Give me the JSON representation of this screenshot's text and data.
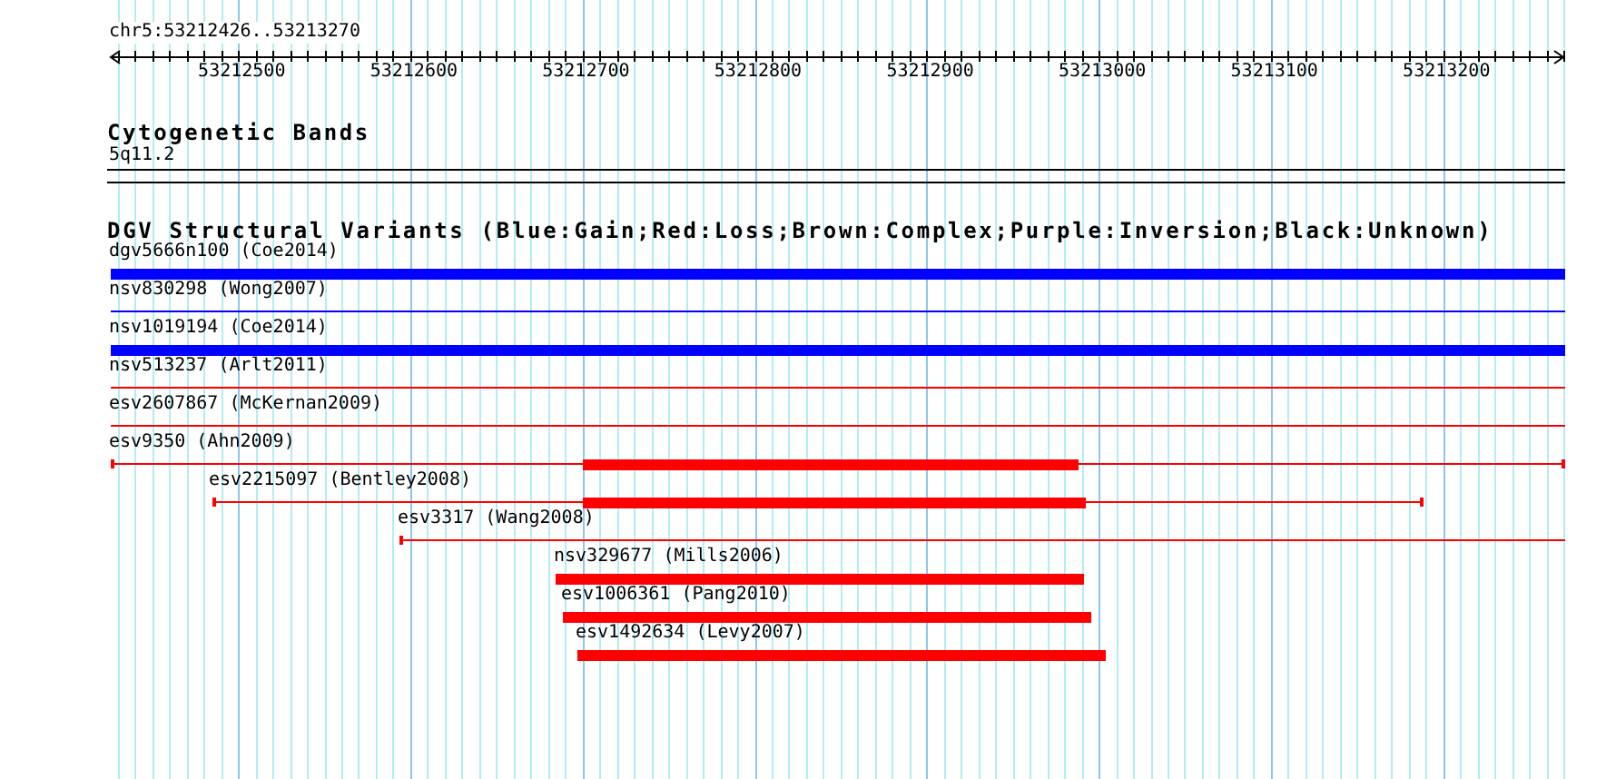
{
  "ruler": {
    "position": "chr5:53212426..53213270",
    "ticks": [
      "53212500",
      "53212600",
      "53212700",
      "53212800",
      "53212900",
      "53213000",
      "53213100",
      "53213200"
    ]
  },
  "cytogenetic_bands": {
    "title": "Cytogenetic Bands",
    "band": "5q11.2"
  },
  "variants": {
    "title": "DGV Structural Variants (Blue:Gain;Red:Loss;Brown:Complex;Purple:Inversion;Black:Unknown)",
    "features": [
      {
        "label": "dgv5666n100 (Coe2014)",
        "color": "#0000ff",
        "kind": "solid"
      },
      {
        "label": "nsv830298 (Wong2007)",
        "color": "#0000ff",
        "kind": "line"
      },
      {
        "label": "nsv1019194 (Coe2014)",
        "color": "#0000ff",
        "kind": "solid"
      },
      {
        "label": "nsv513237 (Arlt2011)",
        "color": "#ff0000",
        "kind": "line"
      },
      {
        "label": "esv2607867 (McKernan2009)",
        "color": "#ff0000",
        "kind": "line"
      },
      {
        "label": "esv9350 (Ahn2009)",
        "color": "#ff0000",
        "kind": "split"
      },
      {
        "label": "esv2215097 (Bentley2008)",
        "color": "#ff0000",
        "kind": "split"
      },
      {
        "label": "esv3317 (Wang2008)",
        "color": "#ff0000",
        "kind": "line"
      },
      {
        "label": "nsv329677 (Mills2006)",
        "color": "#ff0000",
        "kind": "solid"
      },
      {
        "label": "esv1006361 (Pang2010)",
        "color": "#ff0000",
        "kind": "solid"
      },
      {
        "label": "esv1492634 (Levy2007)",
        "color": "#ff0000",
        "kind": "solid"
      }
    ]
  }
}
